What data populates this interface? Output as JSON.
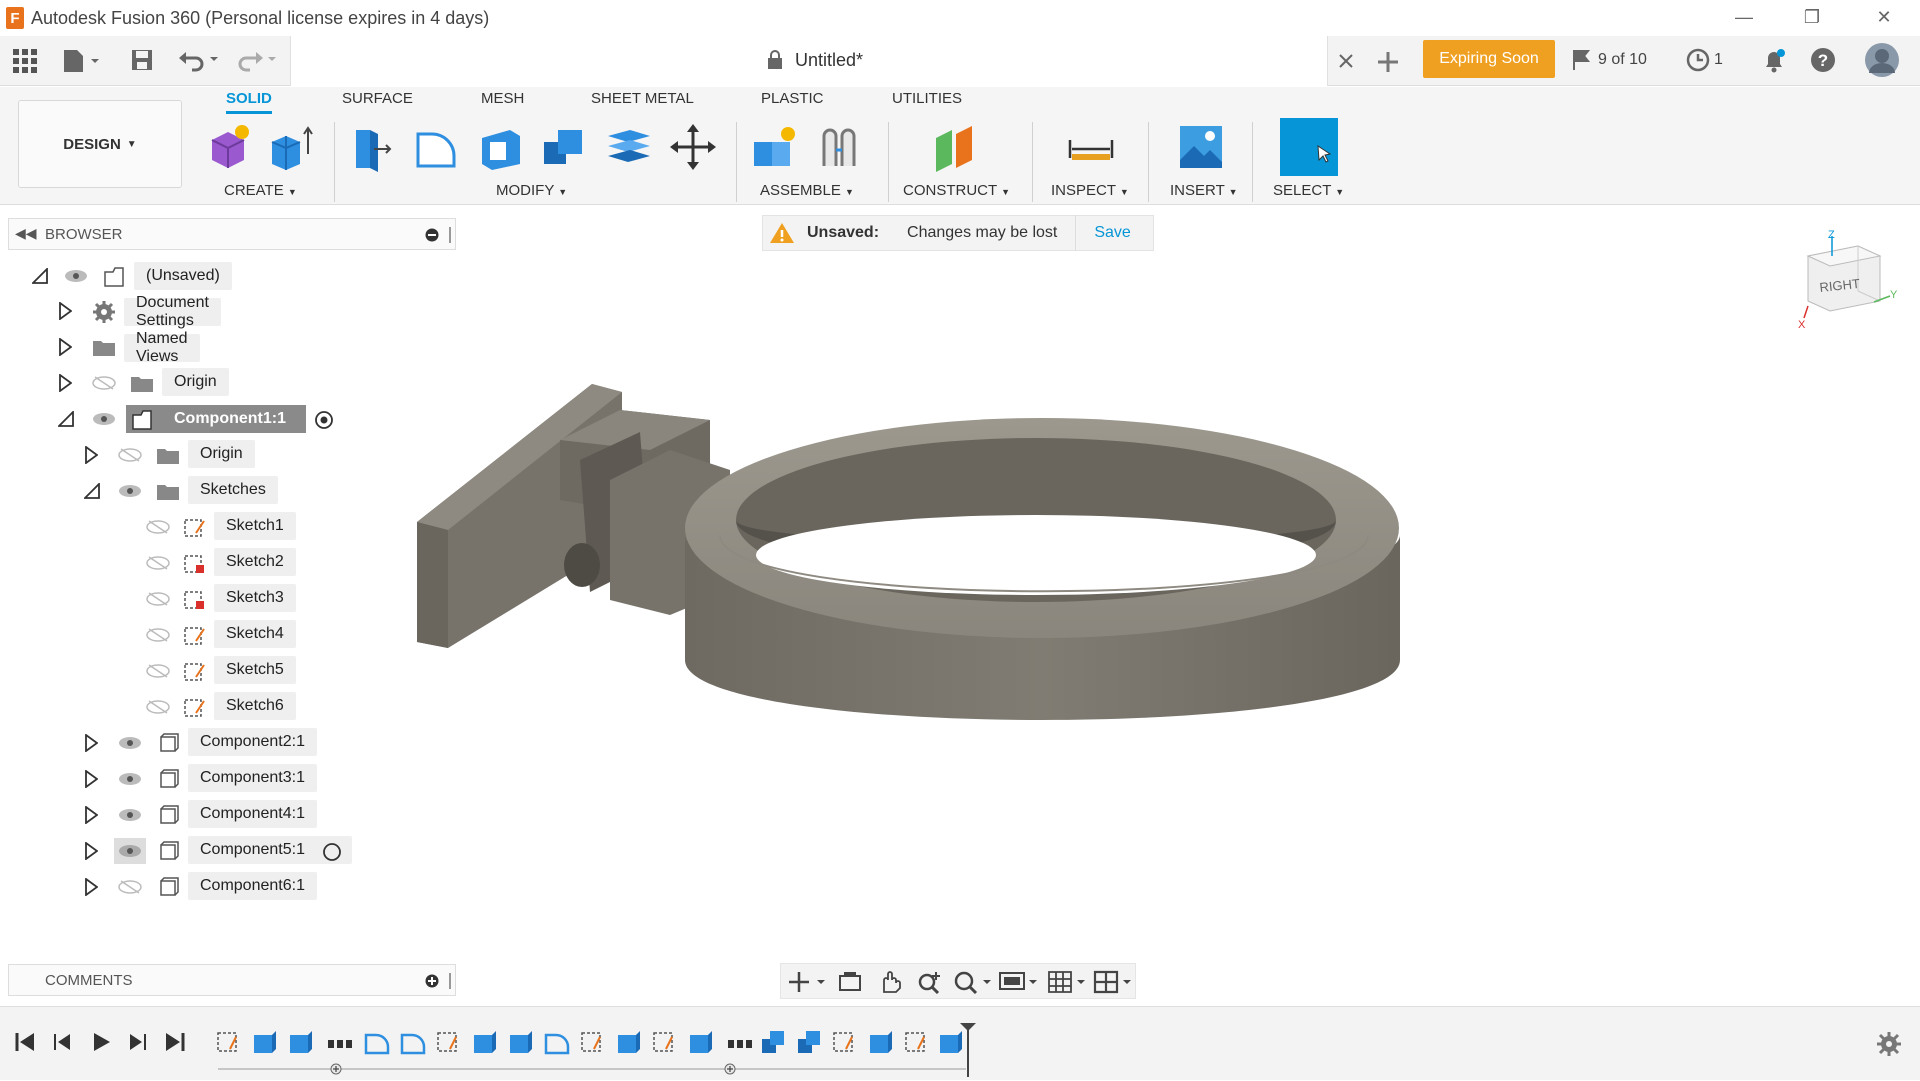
{
  "window": {
    "title": "Autodesk Fusion 360 (Personal license expires in 4 days)",
    "logo_letter": "F"
  },
  "tabbar": {
    "doc_title": "Untitled*",
    "expiring_label": "Expiring Soon",
    "jobs_count": "9 of 10",
    "clock_count": "1"
  },
  "ribbon": {
    "workspace": "DESIGN",
    "tabs": [
      "SOLID",
      "SURFACE",
      "MESH",
      "SHEET METAL",
      "PLASTIC",
      "UTILITIES"
    ],
    "groups": [
      "CREATE",
      "MODIFY",
      "ASSEMBLE",
      "CONSTRUCT",
      "INSPECT",
      "INSERT",
      "SELECT"
    ]
  },
  "browser": {
    "title": "BROWSER",
    "root": "(Unsaved)",
    "items": [
      "Document Settings",
      "Named Views",
      "Origin",
      "Component1:1",
      "Origin",
      "Sketches",
      "Sketch1",
      "Sketch2",
      "Sketch3",
      "Sketch4",
      "Sketch5",
      "Sketch6",
      "Component2:1",
      "Component3:1",
      "Component4:1",
      "Component5:1",
      "Component6:1"
    ]
  },
  "banner": {
    "unsaved": "Unsaved:",
    "message": "Changes may be lost",
    "save": "Save"
  },
  "viewcube": {
    "face": "RIGHT",
    "z": "Z",
    "y": "Y",
    "x": "X"
  },
  "comments": {
    "title": "COMMENTS"
  },
  "colors": {
    "accent": "#0696d7",
    "expiring": "#f0a020",
    "model": "#7f7b72"
  }
}
